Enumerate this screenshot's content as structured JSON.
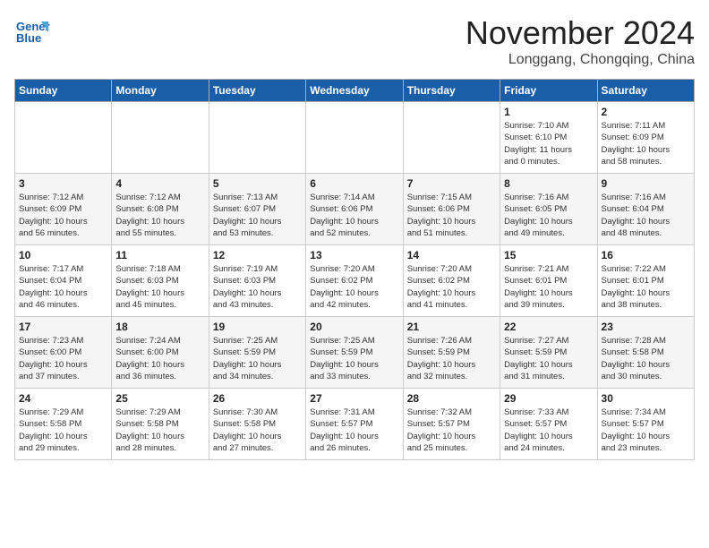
{
  "header": {
    "logo_line1": "General",
    "logo_line2": "Blue",
    "month": "November 2024",
    "location": "Longgang, Chongqing, China"
  },
  "weekdays": [
    "Sunday",
    "Monday",
    "Tuesday",
    "Wednesday",
    "Thursday",
    "Friday",
    "Saturday"
  ],
  "weeks": [
    [
      {
        "day": "",
        "info": ""
      },
      {
        "day": "",
        "info": ""
      },
      {
        "day": "",
        "info": ""
      },
      {
        "day": "",
        "info": ""
      },
      {
        "day": "",
        "info": ""
      },
      {
        "day": "1",
        "info": "Sunrise: 7:10 AM\nSunset: 6:10 PM\nDaylight: 11 hours\nand 0 minutes."
      },
      {
        "day": "2",
        "info": "Sunrise: 7:11 AM\nSunset: 6:09 PM\nDaylight: 10 hours\nand 58 minutes."
      }
    ],
    [
      {
        "day": "3",
        "info": "Sunrise: 7:12 AM\nSunset: 6:09 PM\nDaylight: 10 hours\nand 56 minutes."
      },
      {
        "day": "4",
        "info": "Sunrise: 7:12 AM\nSunset: 6:08 PM\nDaylight: 10 hours\nand 55 minutes."
      },
      {
        "day": "5",
        "info": "Sunrise: 7:13 AM\nSunset: 6:07 PM\nDaylight: 10 hours\nand 53 minutes."
      },
      {
        "day": "6",
        "info": "Sunrise: 7:14 AM\nSunset: 6:06 PM\nDaylight: 10 hours\nand 52 minutes."
      },
      {
        "day": "7",
        "info": "Sunrise: 7:15 AM\nSunset: 6:06 PM\nDaylight: 10 hours\nand 51 minutes."
      },
      {
        "day": "8",
        "info": "Sunrise: 7:16 AM\nSunset: 6:05 PM\nDaylight: 10 hours\nand 49 minutes."
      },
      {
        "day": "9",
        "info": "Sunrise: 7:16 AM\nSunset: 6:04 PM\nDaylight: 10 hours\nand 48 minutes."
      }
    ],
    [
      {
        "day": "10",
        "info": "Sunrise: 7:17 AM\nSunset: 6:04 PM\nDaylight: 10 hours\nand 46 minutes."
      },
      {
        "day": "11",
        "info": "Sunrise: 7:18 AM\nSunset: 6:03 PM\nDaylight: 10 hours\nand 45 minutes."
      },
      {
        "day": "12",
        "info": "Sunrise: 7:19 AM\nSunset: 6:03 PM\nDaylight: 10 hours\nand 43 minutes."
      },
      {
        "day": "13",
        "info": "Sunrise: 7:20 AM\nSunset: 6:02 PM\nDaylight: 10 hours\nand 42 minutes."
      },
      {
        "day": "14",
        "info": "Sunrise: 7:20 AM\nSunset: 6:02 PM\nDaylight: 10 hours\nand 41 minutes."
      },
      {
        "day": "15",
        "info": "Sunrise: 7:21 AM\nSunset: 6:01 PM\nDaylight: 10 hours\nand 39 minutes."
      },
      {
        "day": "16",
        "info": "Sunrise: 7:22 AM\nSunset: 6:01 PM\nDaylight: 10 hours\nand 38 minutes."
      }
    ],
    [
      {
        "day": "17",
        "info": "Sunrise: 7:23 AM\nSunset: 6:00 PM\nDaylight: 10 hours\nand 37 minutes."
      },
      {
        "day": "18",
        "info": "Sunrise: 7:24 AM\nSunset: 6:00 PM\nDaylight: 10 hours\nand 36 minutes."
      },
      {
        "day": "19",
        "info": "Sunrise: 7:25 AM\nSunset: 5:59 PM\nDaylight: 10 hours\nand 34 minutes."
      },
      {
        "day": "20",
        "info": "Sunrise: 7:25 AM\nSunset: 5:59 PM\nDaylight: 10 hours\nand 33 minutes."
      },
      {
        "day": "21",
        "info": "Sunrise: 7:26 AM\nSunset: 5:59 PM\nDaylight: 10 hours\nand 32 minutes."
      },
      {
        "day": "22",
        "info": "Sunrise: 7:27 AM\nSunset: 5:59 PM\nDaylight: 10 hours\nand 31 minutes."
      },
      {
        "day": "23",
        "info": "Sunrise: 7:28 AM\nSunset: 5:58 PM\nDaylight: 10 hours\nand 30 minutes."
      }
    ],
    [
      {
        "day": "24",
        "info": "Sunrise: 7:29 AM\nSunset: 5:58 PM\nDaylight: 10 hours\nand 29 minutes."
      },
      {
        "day": "25",
        "info": "Sunrise: 7:29 AM\nSunset: 5:58 PM\nDaylight: 10 hours\nand 28 minutes."
      },
      {
        "day": "26",
        "info": "Sunrise: 7:30 AM\nSunset: 5:58 PM\nDaylight: 10 hours\nand 27 minutes."
      },
      {
        "day": "27",
        "info": "Sunrise: 7:31 AM\nSunset: 5:57 PM\nDaylight: 10 hours\nand 26 minutes."
      },
      {
        "day": "28",
        "info": "Sunrise: 7:32 AM\nSunset: 5:57 PM\nDaylight: 10 hours\nand 25 minutes."
      },
      {
        "day": "29",
        "info": "Sunrise: 7:33 AM\nSunset: 5:57 PM\nDaylight: 10 hours\nand 24 minutes."
      },
      {
        "day": "30",
        "info": "Sunrise: 7:34 AM\nSunset: 5:57 PM\nDaylight: 10 hours\nand 23 minutes."
      }
    ]
  ]
}
